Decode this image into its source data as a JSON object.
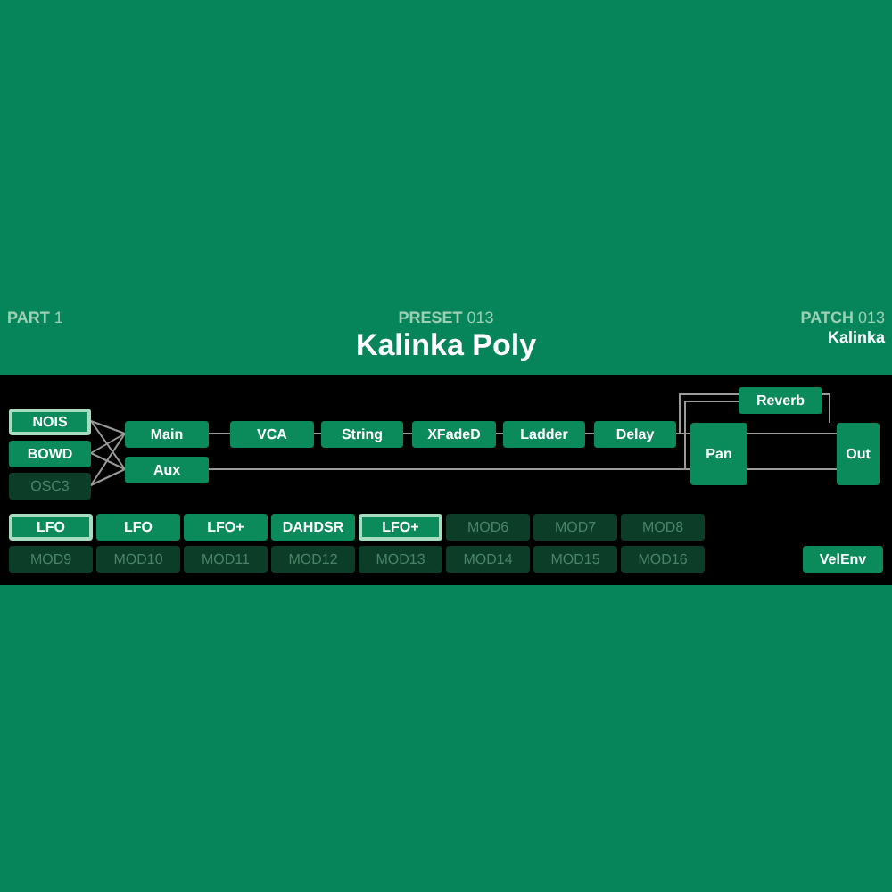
{
  "header": {
    "part": {
      "label": "PART",
      "number": "1"
    },
    "preset": {
      "label": "PRESET",
      "number": "013",
      "name": "Kalinka Poly"
    },
    "patch": {
      "label": "PATCH",
      "number": "013",
      "name": "Kalinka"
    }
  },
  "sources": [
    {
      "label": "NOIS",
      "active": true,
      "selected": true
    },
    {
      "label": "BOWD",
      "active": true,
      "selected": false
    },
    {
      "label": "OSC3",
      "active": false,
      "selected": false
    }
  ],
  "chain": [
    {
      "label": "Main"
    },
    {
      "label": "Aux"
    },
    {
      "label": "VCA"
    },
    {
      "label": "String"
    },
    {
      "label": "XFadeD"
    },
    {
      "label": "Ladder"
    },
    {
      "label": "Delay"
    },
    {
      "label": "Pan"
    },
    {
      "label": "Reverb"
    },
    {
      "label": "Out"
    }
  ],
  "modulators": [
    {
      "label": "LFO",
      "active": true,
      "selected": true
    },
    {
      "label": "LFO",
      "active": true,
      "selected": false
    },
    {
      "label": "LFO+",
      "active": true,
      "selected": false
    },
    {
      "label": "DAHDSR",
      "active": true,
      "selected": false
    },
    {
      "label": "LFO+",
      "active": true,
      "selected": true
    },
    {
      "label": "MOD6",
      "active": false,
      "selected": false
    },
    {
      "label": "MOD7",
      "active": false,
      "selected": false
    },
    {
      "label": "MOD8",
      "active": false,
      "selected": false
    },
    {
      "label": "MOD9",
      "active": false,
      "selected": false
    },
    {
      "label": "MOD10",
      "active": false,
      "selected": false
    },
    {
      "label": "MOD11",
      "active": false,
      "selected": false
    },
    {
      "label": "MOD12",
      "active": false,
      "selected": false
    },
    {
      "label": "MOD13",
      "active": false,
      "selected": false
    },
    {
      "label": "MOD14",
      "active": false,
      "selected": false
    },
    {
      "label": "MOD15",
      "active": false,
      "selected": false
    },
    {
      "label": "MOD16",
      "active": false,
      "selected": false
    }
  ],
  "envelope_button": {
    "label": "VelEnv"
  }
}
